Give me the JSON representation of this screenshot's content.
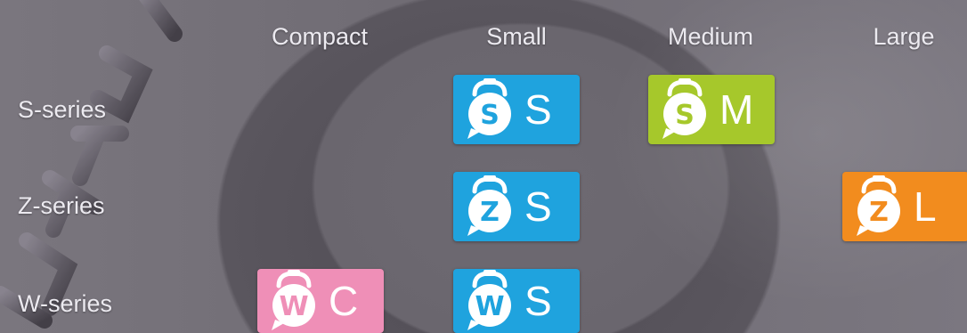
{
  "columns": [
    "Compact",
    "Small",
    "Medium",
    "Large"
  ],
  "rows": [
    "S-series",
    "Z-series",
    "W-series"
  ],
  "badges": [
    {
      "series_letter": "S",
      "size_letter": "S",
      "color": "#1fa3de"
    },
    {
      "series_letter": "S",
      "size_letter": "M",
      "color": "#a6c82b"
    },
    {
      "series_letter": "Z",
      "size_letter": "S",
      "color": "#1fa3de"
    },
    {
      "series_letter": "Z",
      "size_letter": "L",
      "color": "#f28c1e"
    },
    {
      "series_letter": "W",
      "size_letter": "C",
      "color": "#ef8fb7"
    },
    {
      "series_letter": "W",
      "size_letter": "S",
      "color": "#1fa3de"
    }
  ]
}
